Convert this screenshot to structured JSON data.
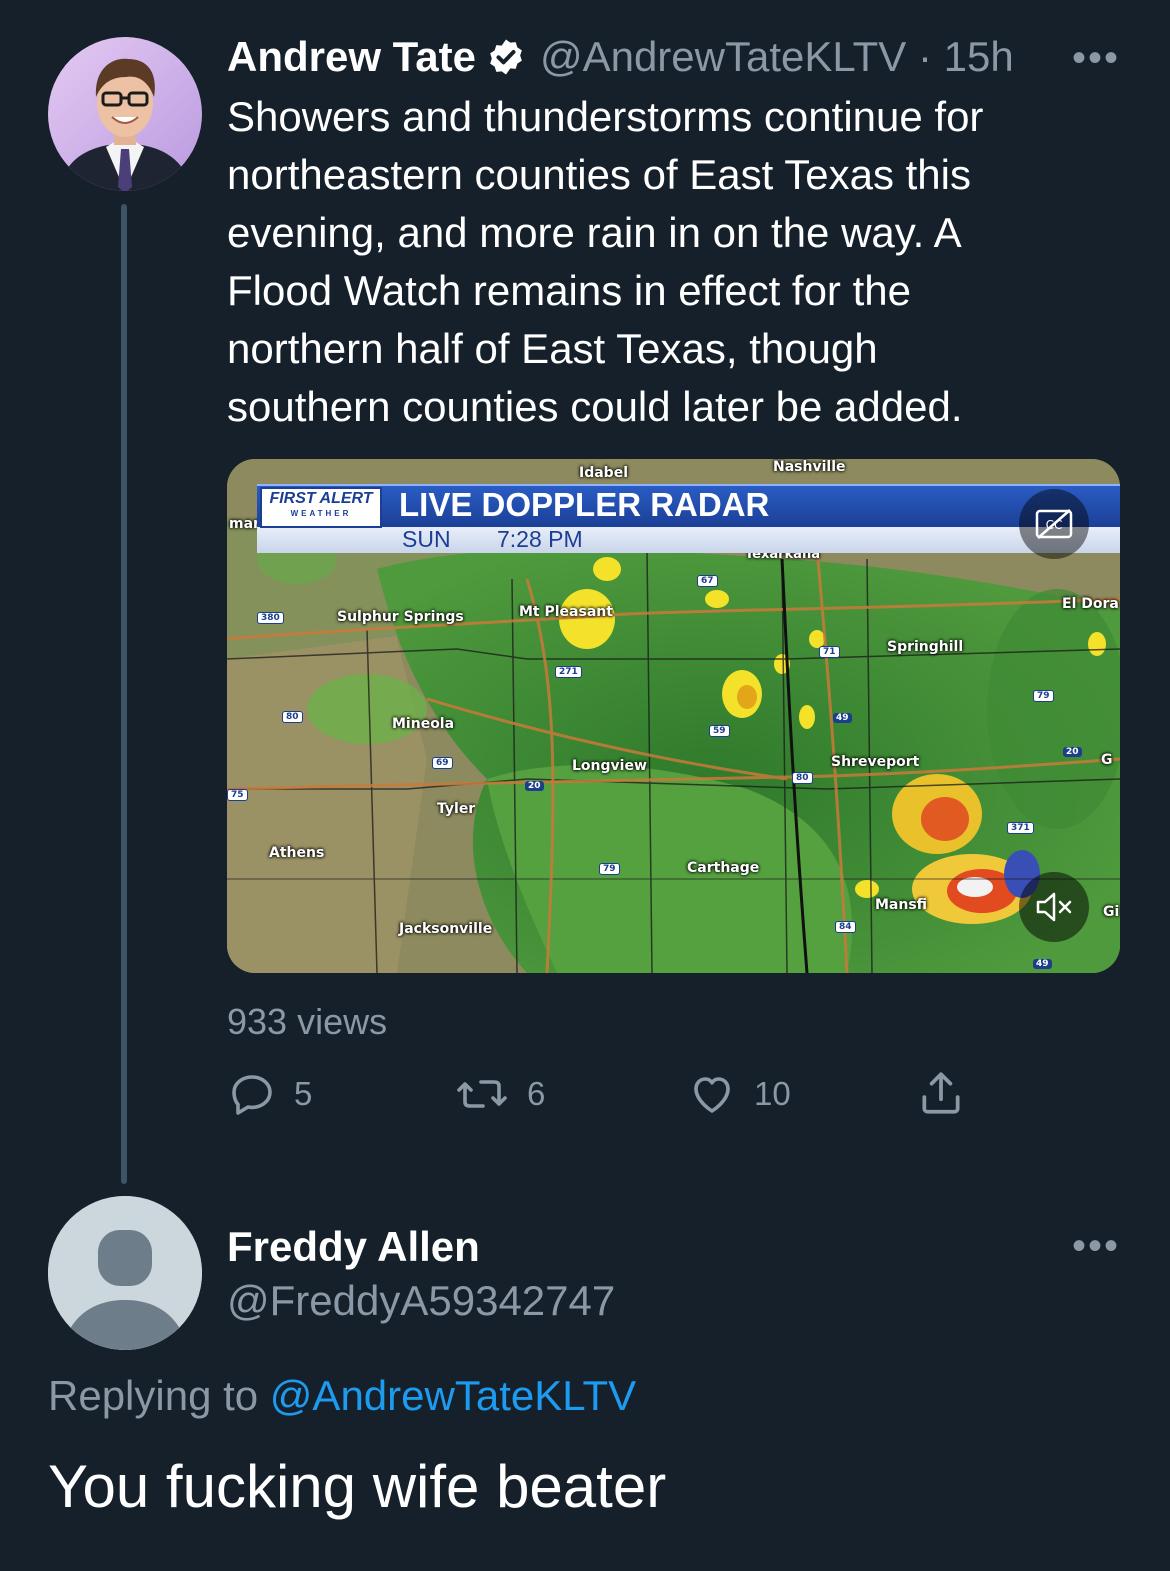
{
  "tweet": {
    "author_name": "Andrew Tate",
    "handle_time": "@AndrewTateKLTV · 15h",
    "text_lines": [
      "Showers and thunderstorms continue for",
      "northeastern counties of East Texas this",
      "evening, and more rain in on the way. A",
      "Flood Watch remains in effect for the",
      "northern half of East Texas, though",
      "southern counties could later be added."
    ],
    "more_icon": "more-horizontal-icon",
    "verified_icon": "verified-badge-icon",
    "views": "933 views",
    "actions": {
      "reply_count": "5",
      "retweet_count": "6",
      "like_count": "10"
    },
    "media": {
      "brand_line1": "FIRST ALERT",
      "brand_line2": "WEATHER",
      "headline": "LIVE DOPPLER RADAR",
      "day": "SUN",
      "time": "7:28 PM",
      "cities": [
        "Idabel",
        "Nashville",
        "Texarkana",
        "El Dora",
        "Sulphur Springs",
        "Mt Pleasant",
        "Springhill",
        "Mineola",
        "Longview",
        "Shreveport",
        "Tyler",
        "Athens",
        "Carthage",
        "Mansfi",
        "Jacksonville",
        "mar",
        "G",
        "Gi"
      ],
      "highway_shields": [
        "380",
        "67",
        "271",
        "71",
        "79",
        "80",
        "59",
        "49",
        "20",
        "69",
        "20",
        "80",
        "75",
        "79",
        "371",
        "84",
        "49"
      ],
      "cc_icon": "captions-icon",
      "mute_icon": "volume-muted-icon"
    }
  },
  "reply": {
    "author_name": "Freddy Allen",
    "handle": "@FreddyA59342747",
    "replying_prefix": "Replying to",
    "replying_to": "@AndrewTateKLTV",
    "text": "You fucking wife beater",
    "more_icon": "more-horizontal-icon"
  },
  "colors": {
    "background": "#15202b",
    "muted": "#8b98a5",
    "link": "#1d9bf0",
    "thread_line": "#3d5466"
  }
}
